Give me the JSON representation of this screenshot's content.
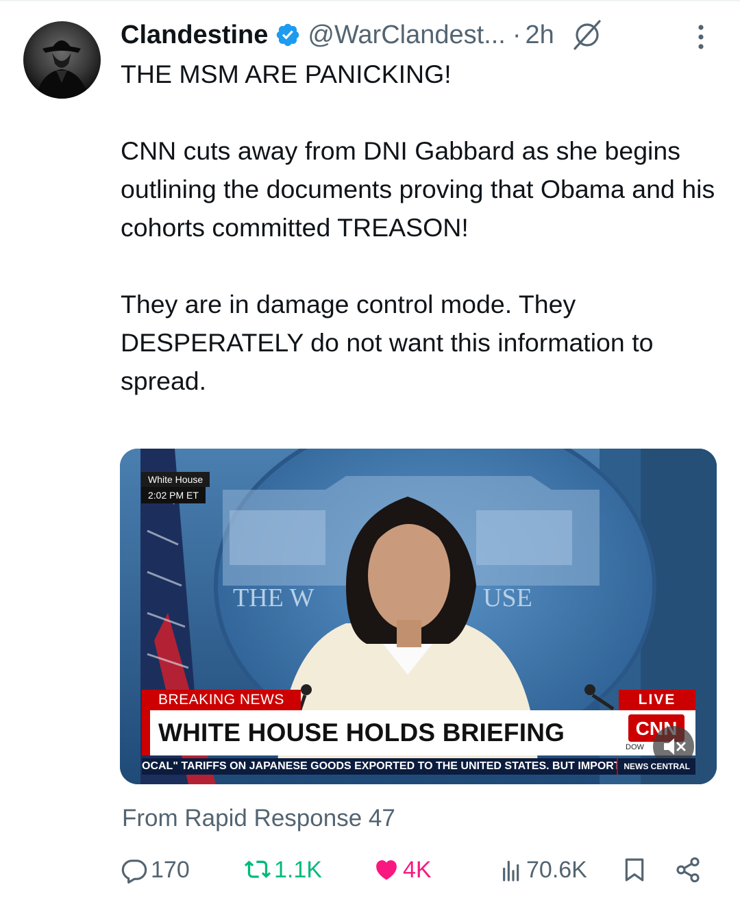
{
  "author": {
    "name": "Clandestine",
    "handle": "@WarClandest...",
    "separator": "·",
    "time": "2h"
  },
  "tweet": {
    "text": "THE MSM ARE PANICKING!\n\nCNN cuts away from DNI Gabbard as she begins outlining the documents proving that Obama and his cohorts committed TREASON!\n\nThey are in damage control mode. They DESPERATELY do not want this information to spread."
  },
  "media": {
    "location_tag": "White House",
    "time_tag": "2:02 PM ET",
    "backdrop_text_left": "THE W",
    "backdrop_text_right": "USE",
    "breaking_label": "BREAKING NEWS",
    "live_label": "LIVE",
    "headline": "WHITE HOUSE HOLDS BRIEFING",
    "network_logo": "CNN",
    "dow_label": "DOW",
    "ticker": "OCAL\" TARIFFS ON JAPANESE GOODS EXPORTED TO THE UNITED STATES. BUT IMPORT",
    "news_central": "NEWS CENTRAL"
  },
  "source": "From Rapid Response 47",
  "actions": {
    "replies": "170",
    "reposts": "1.1K",
    "likes": "4K",
    "views": "70.6K"
  },
  "colors": {
    "text": "#0f1419",
    "secondary": "#536471",
    "verified": "#1d9bf0",
    "repost": "#00ba7c",
    "like": "#f91880",
    "cnn_red": "#cc0000"
  }
}
